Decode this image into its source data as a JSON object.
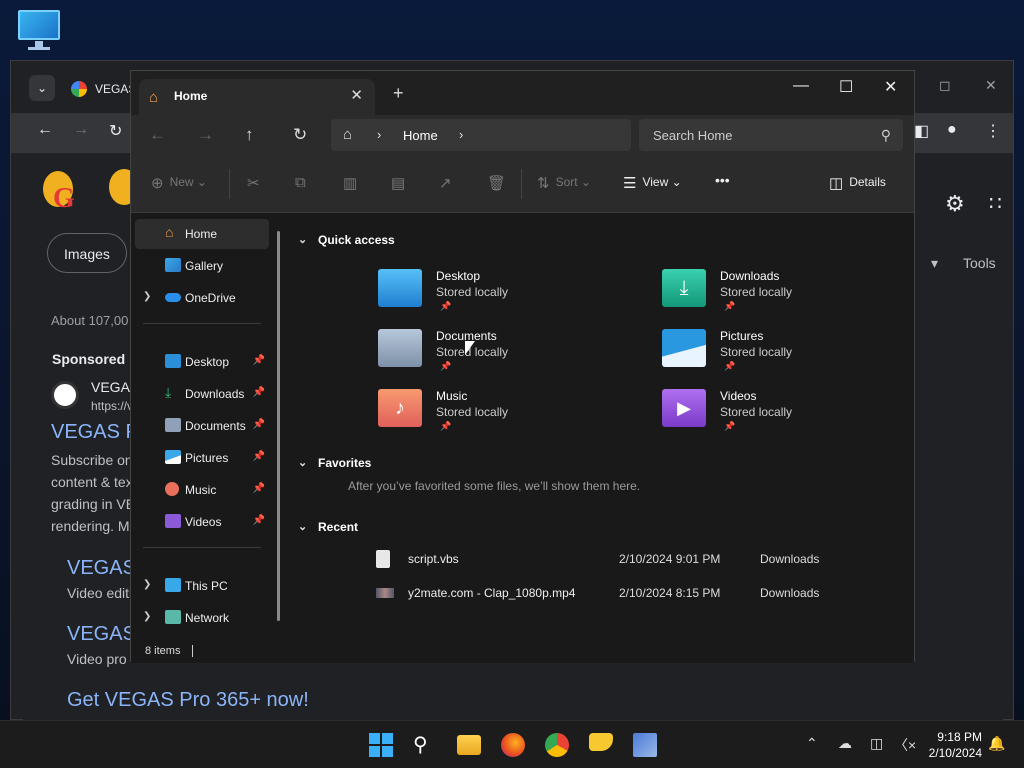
{
  "chrome": {
    "tab_title": "VEGAS",
    "dropdown_icon": "chevron-down-icon",
    "images_pill": "Images",
    "tools_label": "Tools",
    "about_results": "About 107,00",
    "sponsored": "Sponsored",
    "ad_name": "VEGAS",
    "ad_url": "https://v",
    "ad_title": "VEGAS P",
    "ad_desc": [
      "Subscribe on",
      "content & tex",
      "grading in VE",
      "rendering. M"
    ],
    "result1_title": "VEGAS",
    "result1_sub": "Video editi",
    "result2_title": "VEGAS",
    "result2_sub": "Video pro",
    "result3_title": "Get VEGAS Pro 365+ now!"
  },
  "explorer": {
    "tab_title": "Home",
    "address_crumb": "Home",
    "search_placeholder": "Search Home",
    "commands": {
      "new": "New",
      "sort": "Sort",
      "view": "View",
      "more": "•••",
      "details": "Details"
    },
    "sidebar": {
      "top": [
        {
          "label": "Home",
          "icon": "home-icon",
          "selected": true
        },
        {
          "label": "Gallery",
          "icon": "gallery-icon"
        },
        {
          "label": "OneDrive",
          "icon": "cloud-icon",
          "expandable": true
        }
      ],
      "pinned": [
        {
          "label": "Desktop",
          "icon": "desktop-folder-icon",
          "color": "#2a8fd8"
        },
        {
          "label": "Downloads",
          "icon": "download-icon",
          "color": "#2fb87a"
        },
        {
          "label": "Documents",
          "icon": "documents-icon",
          "color": "#8fa0b8"
        },
        {
          "label": "Pictures",
          "icon": "pictures-icon",
          "color": "#3aa8e8"
        },
        {
          "label": "Music",
          "icon": "music-icon",
          "color": "#e8705a"
        },
        {
          "label": "Videos",
          "icon": "videos-icon",
          "color": "#8a5ad8"
        }
      ],
      "bottom": [
        {
          "label": "This PC",
          "icon": "computer-icon"
        },
        {
          "label": "Network",
          "icon": "network-icon"
        }
      ]
    },
    "quick_access": {
      "header": "Quick access",
      "items": [
        {
          "name": "Desktop",
          "status": "Stored locally",
          "icon": "desktop-folder-icon",
          "color": "#2a8fd8"
        },
        {
          "name": "Downloads",
          "status": "Stored locally",
          "icon": "downloads-folder-icon",
          "color": "#1fa888"
        },
        {
          "name": "Documents",
          "status": "Stored locally",
          "icon": "documents-folder-icon",
          "color": "#8fa0b8"
        },
        {
          "name": "Pictures",
          "status": "Stored locally",
          "icon": "pictures-folder-icon",
          "color": "#2a98e0"
        },
        {
          "name": "Music",
          "status": "Stored locally",
          "icon": "music-folder-icon",
          "color": "#e8706a"
        },
        {
          "name": "Videos",
          "status": "Stored locally",
          "icon": "videos-folder-icon",
          "color": "#8a4ad0"
        }
      ]
    },
    "favorites": {
      "header": "Favorites",
      "empty_text": "After you’ve favorited some files, we’ll show them here."
    },
    "recent": {
      "header": "Recent",
      "files": [
        {
          "name": "script.vbs",
          "date": "2/10/2024 9:01 PM",
          "location": "Downloads",
          "icon": "script-file-icon"
        },
        {
          "name": "y2mate.com - Clap_1080p.mp4",
          "date": "2/10/2024 8:15 PM",
          "location": "Downloads",
          "icon": "video-file-icon"
        }
      ]
    },
    "status": {
      "item_count": "8 items"
    }
  },
  "taskbar": {
    "time": "9:18 PM",
    "date": "2/10/2024",
    "apps": [
      "start-icon",
      "search-icon",
      "file-explorer-icon",
      "firefox-icon",
      "chrome-icon",
      "notes-icon",
      "installer-icon"
    ]
  }
}
